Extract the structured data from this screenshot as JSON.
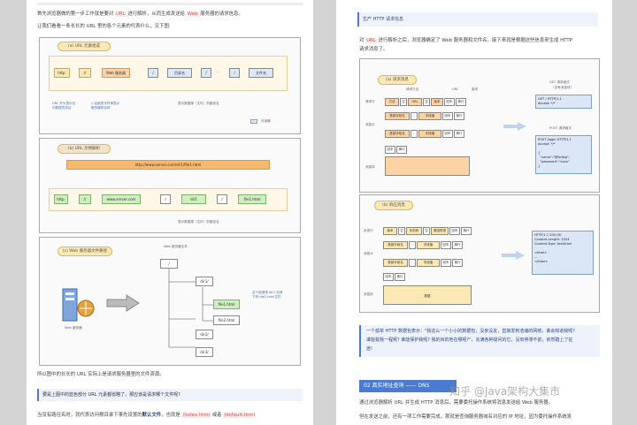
{
  "left_page": {
    "intro_1": [
      "首先浏览器做的第一步工作就是要对 ",
      "URL",
      " 进行解析，从而生成发送给 ",
      "Web",
      " 服务器的请求信息。"
    ],
    "intro_2": "让我们看看一条长长的 URL 里的各个元素的代表什么，见下图:",
    "fig_a": {
      "title": "(a)  URL 元素组成",
      "boxes": [
        "http:",
        "//",
        "Web 服务器",
        "/",
        "目录名",
        "/",
        "...",
        "/",
        "文件名"
      ],
      "note_protocol": "URL 开头表示访\n问数据的协议",
      "note_slash": "// 后面的字符串表示\n服务器的名称",
      "note_path": "表示数据源（文件）的路径名",
      "legend": "可省略"
    },
    "fig_b": {
      "title": "(b)  URL 示例解析",
      "url": "http://www.server.com/dir1/file1.html",
      "boxes": [
        "http:",
        "//",
        "www.server.com",
        "/",
        "dir1",
        "/",
        "file1.html"
      ],
      "note_path": "表示数据源（文件）的路径名"
    },
    "fig_c": {
      "title": "(c)  Web 服务器文件路径",
      "root_label": "Web 服务器文件",
      "server_label": "Web 服务器",
      "nodes": [
        "/",
        "dir1/",
        "file1.html",
        "file2.html",
        "dir2/",
        "dir3/"
      ],
      "note": "这个被请求 dir1 目录\n下的 file1.html文件"
    },
    "after_fig": "所以图中的长长的 URL 实际上是请求服务器里的文件资源。",
    "question": "要是上图中的蓝色部分 URL 元素都省略了，那应该是请求哪个文件呢?",
    "last_1": "当没有路径名时，就代表访问根目录下事先设置的",
    "last_bold": "默认文件",
    "last_2": "，也就是 ",
    "last_f1": "/index.html",
    "last_3": " 或者 ",
    "last_f2": "/default.html"
  },
  "right_page": {
    "heading": "生产 HTTP 请求信息",
    "para_1": [
      "对 ",
      "URL",
      " 进行解析之后，浏览器确定了 Web 服务器和文件名，接下来就是根据这些信息来生成 HTTP"
    ],
    "para_2": "请求消息了。",
    "fig_req": {
      "title": "(a)  请求消息",
      "lbl_method": "请求方法",
      "lbl_url": "URL",
      "lbl_version": "版本",
      "row_labels": [
        "请求行",
        "消息头",
        "",
        "消息体"
      ],
      "row1": [
        "方法",
        "空",
        "URL",
        "空",
        "版本",
        "回车",
        "换行"
      ],
      "row2": [
        "首部字段名",
        "：",
        "字段值",
        "回车",
        "换行"
      ],
      "row3": [
        "首部字段名",
        "：",
        "字段值",
        "回车",
        "换行"
      ],
      "row4": [
        "回车",
        "换行"
      ],
      "body": "",
      "get_title": "GET 请求格式",
      "get_sub": "（没有消息体）",
      "get_text": "GET / HTTP/1.1\nAccept: */*",
      "post_title": "POST 请求格式",
      "post_text": "POST /login HTTP/1.1\nAccept: */*\n\n{\n  \"name\":\"@fsdlog\",\n  \"password\":\"xxxx\"\n}"
    },
    "fig_resp": {
      "title": "(b)  响应消息",
      "row_labels": [
        "状态行",
        "消息头",
        "",
        "消息体"
      ],
      "row1": [
        "版本",
        "空",
        "状态码",
        "空",
        "原因短语",
        "回车",
        "换行"
      ],
      "row2": [
        "首部字段名",
        "：",
        "字段值",
        "回车",
        "换行"
      ],
      "row3": [
        "首部字段名",
        "：",
        "字段值",
        "回车",
        "换行"
      ],
      "row4": [
        "回车",
        "换行"
      ],
      "body": "数据",
      "resp_text": "HTTP/1.1 200 OK\nContent-Length: 1024\nContent-Type: text/html\n\n<html>\n...\n</html>"
    },
    "quote_1": "一个孤单 HTTP 数据包表示：\"我这么一个小小的数据包，没亲没友，直接发到浩瀚的网络，谁会知道我呢?",
    "quote_2": "谁能载我一程呢? 谁能保护我呢? 我的目的地在哪呢?\"，充满各种疑问的它，没有停滞不前，依然踏上了征",
    "quote_3": "途!",
    "section": "02 真实地址查询 —— DNS",
    "para_3": "通过浏览器解析 URL 并生成 HTTP 消息后，需要委托操作系统将消息发送给 Web 服务器。",
    "para_4": "但在发送之前，还有一项工作需要完成，那就是查询服务器域名对应的 IP 地址，因为委托操作系统发",
    "watermark": "知乎 @Java架构大集市"
  }
}
